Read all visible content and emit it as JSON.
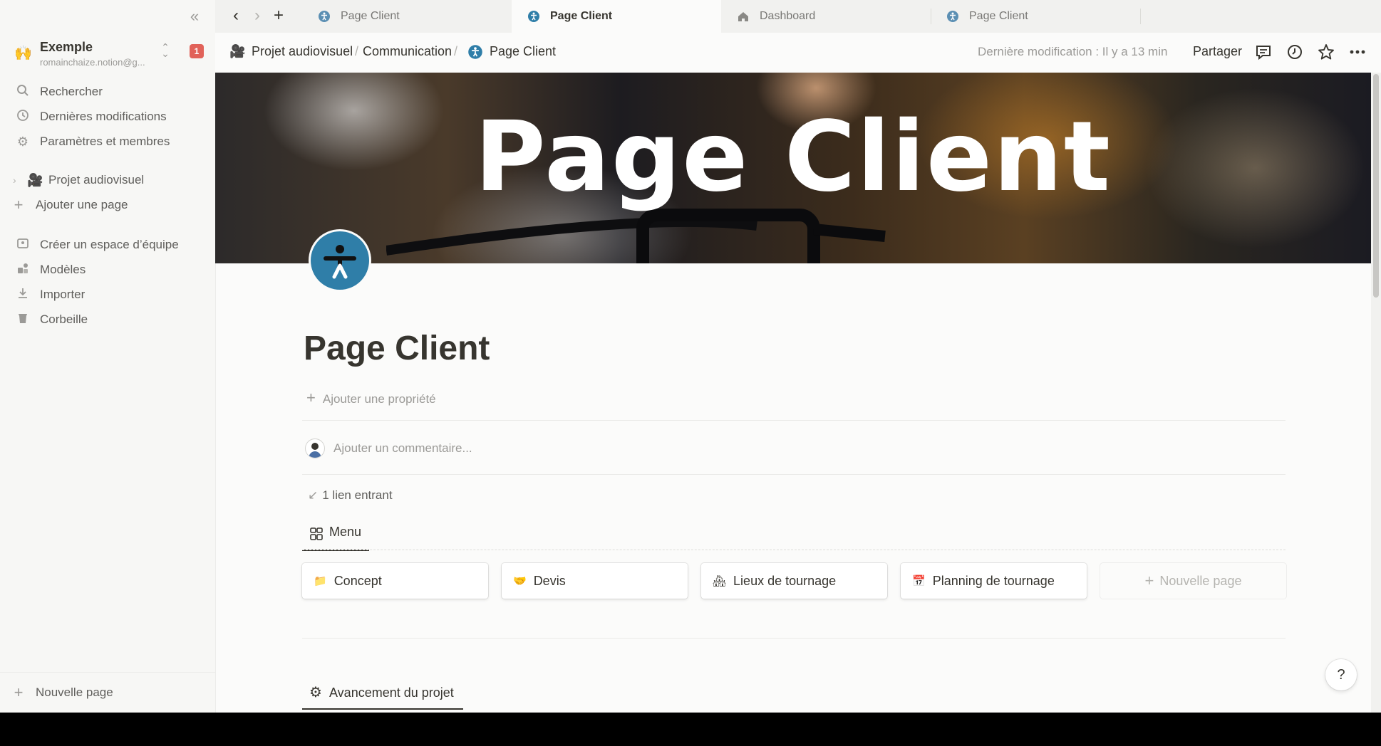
{
  "sidebar": {
    "workspace": {
      "name": "Exemple",
      "email": "romainchaize.notion@g...",
      "badge": "1",
      "emoji": "🙌"
    },
    "top_items": [
      {
        "label": "Rechercher",
        "icon": "search-icon"
      },
      {
        "label": "Dernières modifications",
        "icon": "clock-icon"
      },
      {
        "label": "Paramètres et membres",
        "icon": "gear-icon"
      }
    ],
    "pages": [
      {
        "label": "Projet audiovisuel",
        "icon": "film-camera-icon"
      }
    ],
    "add_page": "Ajouter une page",
    "bottom_items": [
      {
        "label": "Créer un espace d’équipe",
        "icon": "team-space-icon"
      },
      {
        "label": "Modèles",
        "icon": "templates-icon"
      },
      {
        "label": "Importer",
        "icon": "import-icon"
      },
      {
        "label": "Corbeille",
        "icon": "trash-icon"
      }
    ],
    "new_page": "Nouvelle page"
  },
  "tabs": [
    {
      "label": "Page Client",
      "active": false,
      "icon": "accessibility-icon"
    },
    {
      "label": "Page Client",
      "active": true,
      "icon": "accessibility-icon"
    },
    {
      "label": "Dashboard",
      "active": false,
      "icon": "house-icon"
    },
    {
      "label": "Page Client",
      "active": false,
      "icon": "accessibility-icon"
    }
  ],
  "topbar": {
    "breadcrumb": [
      "Projet audiovisuel",
      "Communication",
      "Page Client"
    ],
    "separator": "/",
    "last_modified": "Dernière modification : Il y a 13 min",
    "share": "Partager"
  },
  "cover": {
    "title": "Page Client"
  },
  "page": {
    "title": "Page Client",
    "add_property": "Ajouter une propriété",
    "comment_placeholder": "Ajouter un commentaire...",
    "backlinks": "1 lien entrant",
    "menu_tab": "Menu",
    "cards": [
      {
        "label": "Concept",
        "emoji": "📁"
      },
      {
        "label": "Devis",
        "emoji": "🤝"
      },
      {
        "label": "Lieux de tournage",
        "emoji": "🏘"
      },
      {
        "label": "Planning de tournage",
        "emoji": "📅"
      }
    ],
    "new_card": "Nouvelle page",
    "second_tab": "Avancement du projet"
  },
  "help": "?",
  "colors": {
    "sidebar_bg": "#f7f7f5",
    "page_bg": "#fbfbfa",
    "badge": "#e16259",
    "page_icon": "#2f7ea8",
    "text": "#37352f",
    "muted": "#9b9a97"
  }
}
